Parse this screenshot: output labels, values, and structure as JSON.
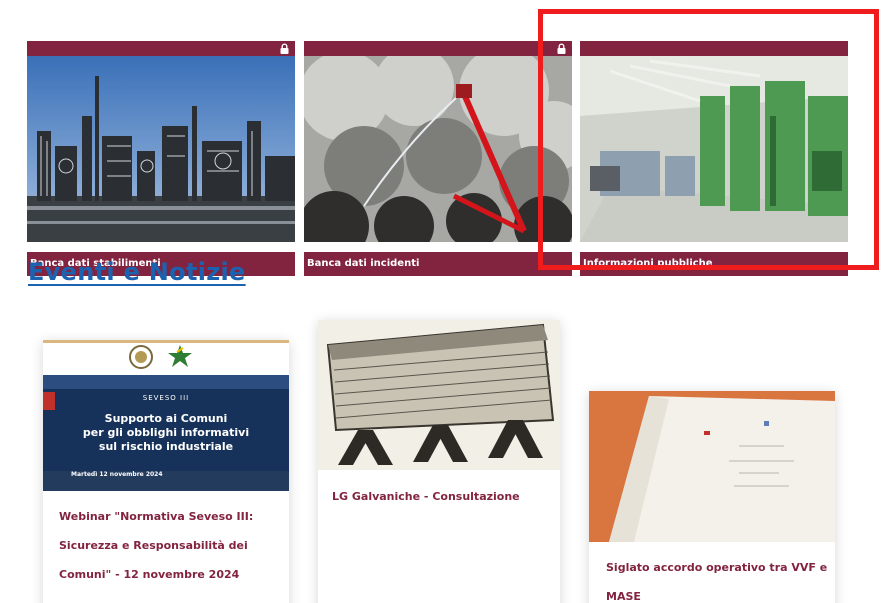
{
  "cards": [
    {
      "label": "Banca dati stabilimenti",
      "locked": true,
      "icon": "lock-icon"
    },
    {
      "label": "Banca dati incidenti",
      "locked": true,
      "icon": "lock-icon"
    },
    {
      "label": "Informazioni pubbliche",
      "locked": false
    }
  ],
  "section": {
    "title": "Eventi e Notizie"
  },
  "news": [
    {
      "title": "Webinar \"Normativa Seveso III: Sicurezza e Responsabilità dei Comuni\" - 12 novembre 2024",
      "banner": {
        "series": "SEVESO III",
        "line1": "Supporto ai Comuni",
        "line2": "per gli obblighi informativi",
        "line3": "sul rischio industriale",
        "date": "Martedì 12 novembre 2024"
      }
    },
    {
      "title": "LG Galvaniche - Consultazione"
    },
    {
      "title": "Siglato accordo operativo tra VVF e MASE"
    }
  ],
  "colors": {
    "brand": "#82243f",
    "link": "#1b63b0",
    "highlight": "#ee1c1c"
  }
}
